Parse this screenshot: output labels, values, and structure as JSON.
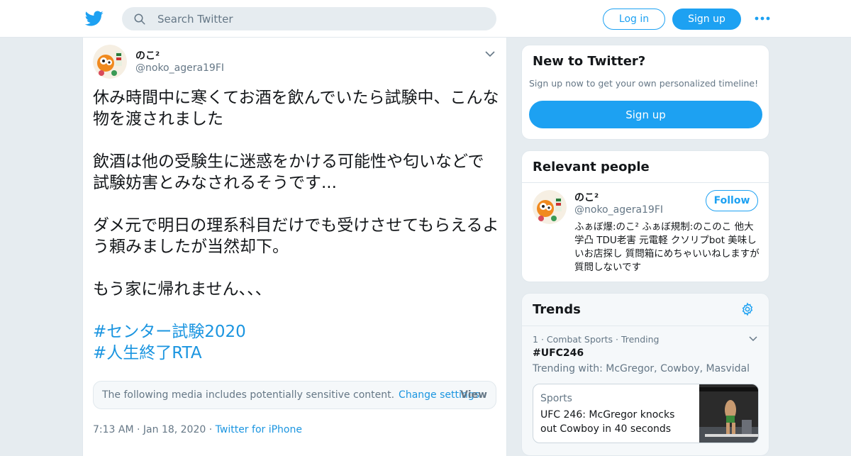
{
  "colors": {
    "accent": "#1da1f2",
    "link": "#1b95e0",
    "muted": "#657786",
    "background": "#e6ecf0"
  },
  "header": {
    "logo_icon": "twitter-bird-icon",
    "search": {
      "placeholder": "Search Twitter",
      "icon": "search-icon"
    },
    "login_label": "Log in",
    "signup_label": "Sign up",
    "more_icon": "more-dots-icon"
  },
  "tweet": {
    "author": {
      "name": "のこ²",
      "handle": "@noko_agera19FI"
    },
    "paragraphs": [
      "休み時間中に寒くてお酒を飲んでいたら試験中、こんな物を渡されました",
      "飲酒は他の受験生に迷惑をかける可能性や匂いなどで試験妨害とみなされるそうです...",
      "ダメ元で明日の理系科目だけでも受けさせてもらえるよう頼みましたが当然却下。",
      "もう家に帰れません、、、"
    ],
    "hashtags": [
      "#センター試験2020",
      "#人生終了RTA"
    ],
    "sensitive_notice": "The following media includes potentially sensitive content.",
    "change_settings_label": "Change settings",
    "view_label": "View",
    "time": "7:13 AM",
    "date": "Jan 18, 2020",
    "source": "Twitter for iPhone",
    "sep": "·"
  },
  "sidebar": {
    "new_to_twitter": {
      "title": "New to Twitter?",
      "subtitle": "Sign up now to get your own personalized timeline!",
      "signup_label": "Sign up"
    },
    "relevant_people": {
      "title": "Relevant people",
      "person": {
        "name": "のこ²",
        "handle": "@noko_agera19FI",
        "follow_label": "Follow",
        "bio": "ふぁぼ爆:のこ² ふぁぼ規制:のこのこ 他大学凸 TDU老害 元電軽 クソリプbot 美味しいお店探し 質問箱にめちゃいいねしますが質問しないです"
      }
    },
    "trends": {
      "title": "Trends",
      "item": {
        "rank": "1",
        "category": "Combat Sports",
        "status": "Trending",
        "name": "#UFC246",
        "trending_with": "Trending with: McGregor, Cowboy, Masvidal",
        "card": {
          "category": "Sports",
          "headline": "UFC 246: McGregor knocks out Cowboy in 40 seconds"
        }
      }
    }
  }
}
